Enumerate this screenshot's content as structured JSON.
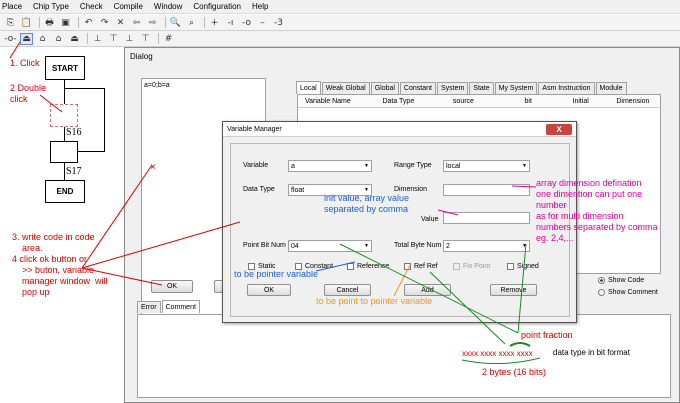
{
  "menu": [
    "Place",
    "Chip Type",
    "Check",
    "Compile",
    "Window",
    "Configuration",
    "Help"
  ],
  "flowchart": {
    "start": "START",
    "end": "END",
    "s16": "S16",
    "s17": "S17"
  },
  "annotations": {
    "click1": "1. Click",
    "dbl_click": "2 Double\nclick",
    "write_code": "3. write code in code\n    area.\n4 click ok button or\n    >> buton, variable\n    manager window  will\n    pop up",
    "init_value": "init value, array value\nseparated by comma",
    "array_dim": "array dimension defination\none dimention can put one\nnumber\nas for multi dimension\nnumbers separated by comma\neg. 2,4,...",
    "to_pointer": "to be pointer variable",
    "to_point_pointer": "to be point to pointer variable",
    "point_fraction": "point fraction",
    "bits": "xxxx xxxx xxxx xxxx",
    "bits_label": "data type in bit format",
    "bytes": "2 bytes (16 bits)"
  },
  "dialog": {
    "title": "Dialog",
    "code": "a=0;b=a",
    "tabs": [
      "Local",
      "Weak Global",
      "Global",
      "Constant",
      "System",
      "State",
      "My System",
      "Asm Instruction",
      "Module"
    ],
    "columns": [
      "Variable Name",
      "Data Type",
      "source",
      "bit",
      "Initial",
      "Dimension"
    ],
    "ok_label": "OK",
    "bottom_tabs": [
      "Error",
      "Comment"
    ],
    "show_code": "Show Code",
    "show_comment": "Show Comment"
  },
  "vm": {
    "title": "Variable Manager",
    "close": "X",
    "variable_label": "Variable",
    "variable_value": "a",
    "range_label": "Range Type",
    "range_value": "local",
    "dtype_label": "Data Type",
    "dtype_value": "float",
    "dimension_label": "Dimension",
    "value_label": "Value",
    "pbn_label": "Point Bit Num",
    "pbn_value": "04",
    "tbn_label": "Total Byte Num",
    "tbn_value": "2",
    "checks": [
      "Static",
      "Constant",
      "Reference",
      "Ref Ref",
      "Fix Point",
      "Signed"
    ],
    "ok": "OK",
    "cancel": "Cancel",
    "add": "Add",
    "remove": "Remove"
  }
}
